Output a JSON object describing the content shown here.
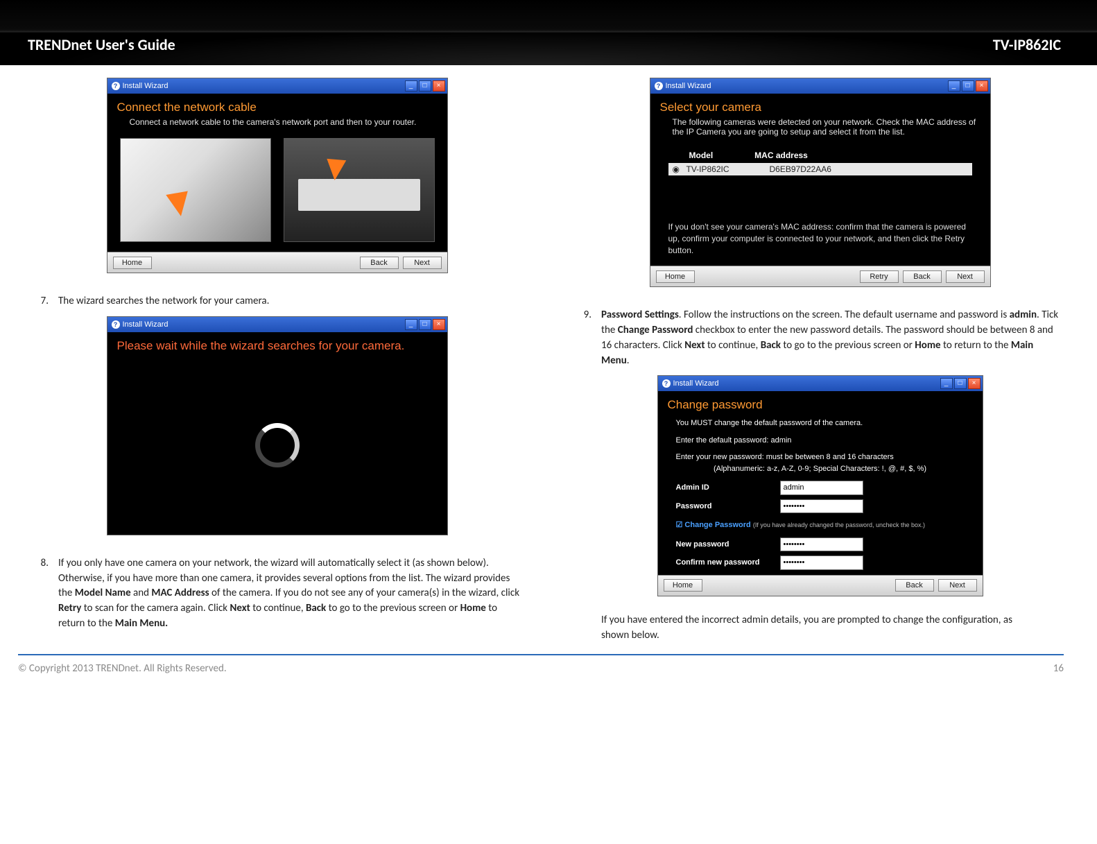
{
  "header": {
    "left": "TRENDnet User's Guide",
    "right": "TV-IP862IC"
  },
  "wizard_title": "Install Wizard",
  "buttons": {
    "home": "Home",
    "back": "Back",
    "next": "Next",
    "retry": "Retry"
  },
  "win1": {
    "heading": "Connect the network cable",
    "sub": "Connect a network cable to the camera's network port and then to your router."
  },
  "win2": {
    "heading": "Please wait while the wizard searches for your camera."
  },
  "win3": {
    "heading": "Select your camera",
    "sub": "The following cameras were detected on your network. Check the MAC address of the IP Camera you are going to setup and select it from the list.",
    "col_model": "Model",
    "col_mac": "MAC address",
    "row_model": "TV-IP862IC",
    "row_mac": "D6EB97D22AA6",
    "note": "If you don't see your camera's MAC address: confirm that the camera is powered up, confirm your computer is connected to your network, and then click the Retry button."
  },
  "win4": {
    "heading": "Change password",
    "l1": "You MUST change the default password of the camera.",
    "l2": "Enter the default password: admin",
    "l3a": "Enter your new password: must be between 8 and 16 characters",
    "l3b": "(Alphanumeric: a-z, A-Z, 0-9; Special Characters: !, @, #, $, %)",
    "lab_id": "Admin ID",
    "val_id": "admin",
    "lab_pw": "Password",
    "val_pw": "••••••••",
    "chk": "Change Password",
    "chk_note": "(If you have already changed the password, uncheck the box.)",
    "lab_new": "New password",
    "val_new": "••••••••",
    "lab_conf": "Confirm new password",
    "val_conf": "••••••••"
  },
  "steps": {
    "n7": {
      "num": "7.",
      "text": "The wizard searches the network for your camera."
    },
    "n8": {
      "num": "8.",
      "t1": "If you only have one camera on your network, the wizard will automatically select it (as shown below). Otherwise, if you have more than one camera, it provides several options from the list. The wizard provides the ",
      "b1": "Model Name",
      "t2": " and ",
      "b2": "MAC Address",
      "t3": " of the camera. If you do not see any of your camera(s) in the wizard, click ",
      "b3": "Retry",
      "t4": " to scan for the camera again. Click ",
      "b4": "Next",
      "t5": " to continue, ",
      "b5": "Back",
      "t6": " to go to the previous screen or ",
      "b6": "Home",
      "t7": " to return to the ",
      "b7": "Main Menu."
    },
    "n9": {
      "num": "9.",
      "b0": "Password Settings",
      "t1": ". Follow the instructions on the screen. The default username and password is ",
      "b1": "admin",
      "t2": ". Tick the ",
      "b2": "Change Password",
      "t3": " checkbox to enter the new password details. The password should be between 8 and 16 characters. Click ",
      "b3": "Next",
      "t4": " to continue, ",
      "b4": "Back",
      "t5": " to go to the previous screen or ",
      "b5": "Home",
      "t6": " to return to the ",
      "b6": "Main Menu",
      "t7": "."
    },
    "pend": "If you have entered the incorrect admin details, you are prompted to change the configuration, as shown below."
  },
  "footer": {
    "copy": "© Copyright 2013 TRENDnet. All Rights Reserved.",
    "page": "16"
  }
}
